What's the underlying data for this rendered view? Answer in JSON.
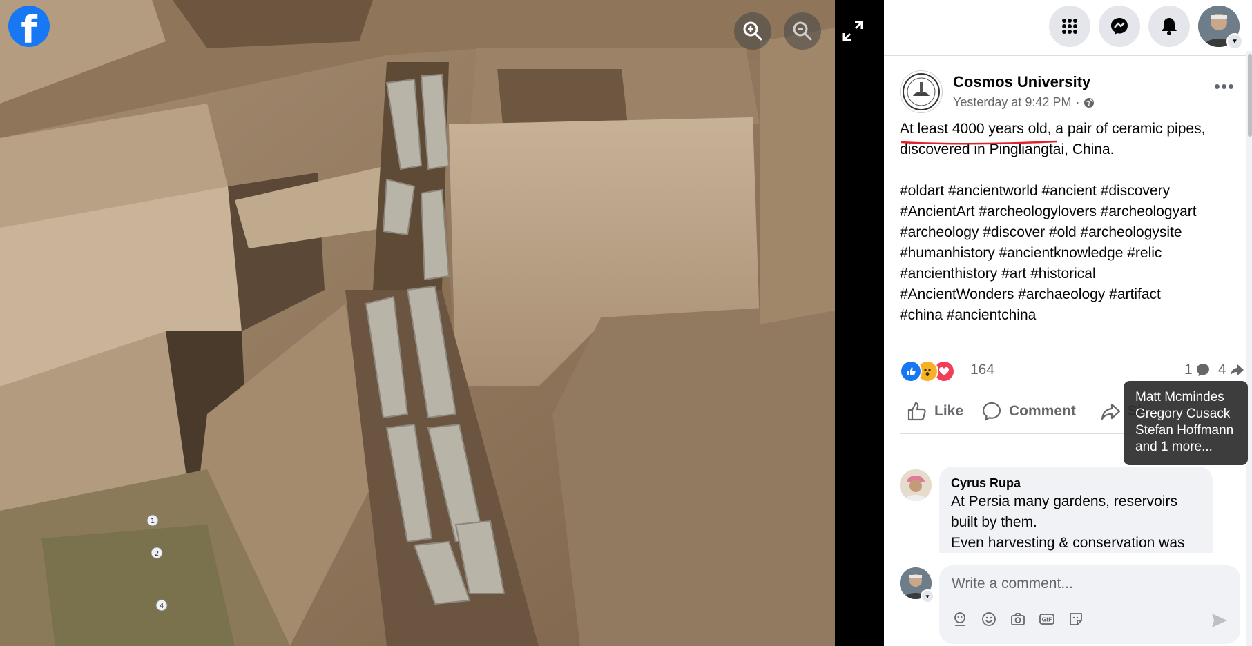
{
  "viewer": {
    "logo_letter": "f",
    "zoom_in_icon": "zoom-in-icon",
    "zoom_out_icon": "zoom-out-icon",
    "fullscreen_icon": "expand-icon",
    "photo_markers": [
      "1",
      "2",
      "4"
    ]
  },
  "nav": {
    "menu_icon": "grid-menu-icon",
    "messenger_icon": "messenger-icon",
    "notifications_icon": "bell-icon"
  },
  "post": {
    "page_name": "Cosmos University",
    "timestamp": "Yesterday at 9:42 PM",
    "separator": "·",
    "privacy_icon": "globe-icon",
    "text_highlight": "At least 4000 years old",
    "text_rest": ", a pair of ceramic pipes,",
    "text_line2": "discovered in Pingliangtai, China.",
    "hashtags": [
      "#oldart #ancientworld #ancient #discovery",
      "#AncientArt #archeologylovers #archeologyart",
      "#archeology #discover #old #archeologysite",
      "#humanhistory #ancientknowledge #relic",
      "#ancienthistory #art #historical",
      "#AncientWonders #archaeology #artifact",
      "#china #ancientchina"
    ]
  },
  "reactions": {
    "count": "164",
    "comments": "1",
    "shares": "4",
    "types": [
      "like",
      "wow",
      "love"
    ]
  },
  "actions": {
    "like": "Like",
    "comment": "Comment",
    "share_partial": "Sh"
  },
  "tooltip": {
    "names": [
      "Matt Mcmindes",
      "Gregory Cusack",
      "Stefan Hoffmann",
      "and 1 more..."
    ]
  },
  "comment": {
    "author": "Cyrus Rupa",
    "lines": [
      "At Persia many gardens, reservoirs",
      "built by them.",
      "Even harvesting & conservation was"
    ]
  },
  "composer": {
    "placeholder": "Write a comment..."
  },
  "colors": {
    "brand": "#1877f2",
    "underline": "#e0242e",
    "secondary_text": "#65676b"
  }
}
